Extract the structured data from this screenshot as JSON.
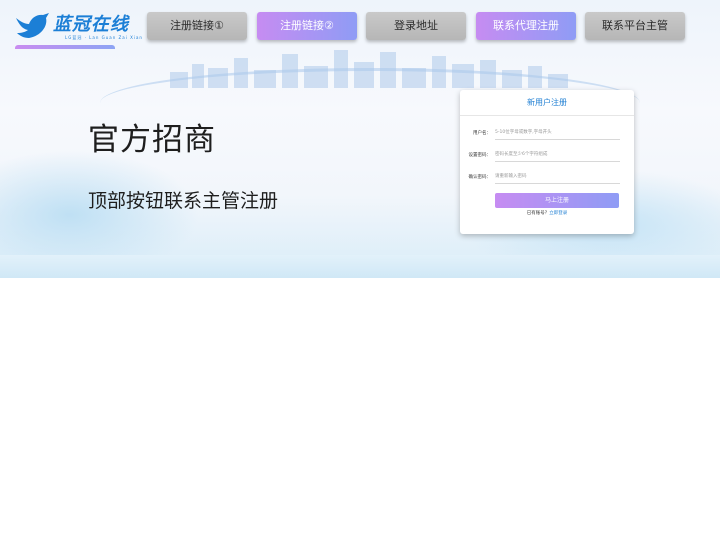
{
  "logo": {
    "name": "蓝冠在线",
    "tagline": "LG蓝冠 · Lan Guan Zai Xian"
  },
  "nav": [
    {
      "label": "注册链接①",
      "style": "gray"
    },
    {
      "label": "注册链接②",
      "style": "purple"
    },
    {
      "label": "登录地址",
      "style": "gray"
    },
    {
      "label": "联系代理注册",
      "style": "purple"
    },
    {
      "label": "联系平台主管",
      "style": "gray"
    }
  ],
  "hero": {
    "title": "官方招商",
    "subtitle": "顶部按钮联系主管注册"
  },
  "register": {
    "title": "新用户注册",
    "username_label": "用户名：",
    "username_placeholder": "5-10位字母或数字,字母开头",
    "password_label": "设置密码：",
    "password_placeholder": "密码长度至少6个字符组成",
    "confirm_label": "确认密码：",
    "confirm_placeholder": "请重新输入密码",
    "submit_label": "马上注册",
    "login_prompt": "已有账号？",
    "login_link": "立即登录"
  },
  "colors": {
    "accent_purple": "#c68cf2",
    "accent_blue": "#8f9cf5",
    "brand_blue": "#1c7fd6"
  }
}
